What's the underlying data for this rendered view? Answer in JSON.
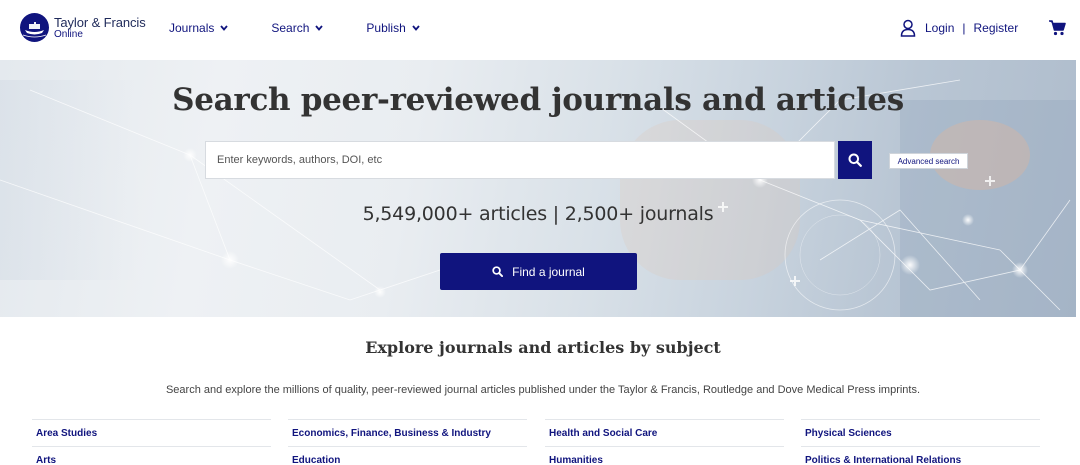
{
  "header": {
    "brand": "Taylor & Francis",
    "brand_sub": "Online",
    "nav": [
      {
        "label": "Journals"
      },
      {
        "label": "Search"
      },
      {
        "label": "Publish"
      }
    ],
    "login": "Login",
    "separator": "|",
    "register": "Register"
  },
  "hero": {
    "title": "Search peer-reviewed journals and articles",
    "search_placeholder": "Enter keywords, authors, DOI, etc",
    "advanced_search": "Advanced search",
    "stats": "5,549,000+ articles | 2,500+ journals",
    "find_journal": "Find a journal"
  },
  "explore": {
    "title": "Explore journals and articles by subject",
    "description": "Search and explore the millions of quality, peer-reviewed journal articles published under the Taylor & Francis, Routledge and Dove Medical Press imprints.",
    "columns": [
      [
        "Area Studies",
        "Arts"
      ],
      [
        "Economics, Finance, Business & Industry",
        "Education"
      ],
      [
        "Health and Social Care",
        "Humanities"
      ],
      [
        "Physical Sciences",
        "Politics & International Relations"
      ]
    ]
  },
  "colors": {
    "brand_navy": "#10147e",
    "text": "#333333"
  },
  "icons": {
    "logo": "taylor-francis-logo-icon",
    "chevron": "chevron-down-icon",
    "user": "user-icon",
    "cart": "cart-icon",
    "search": "search-icon"
  }
}
